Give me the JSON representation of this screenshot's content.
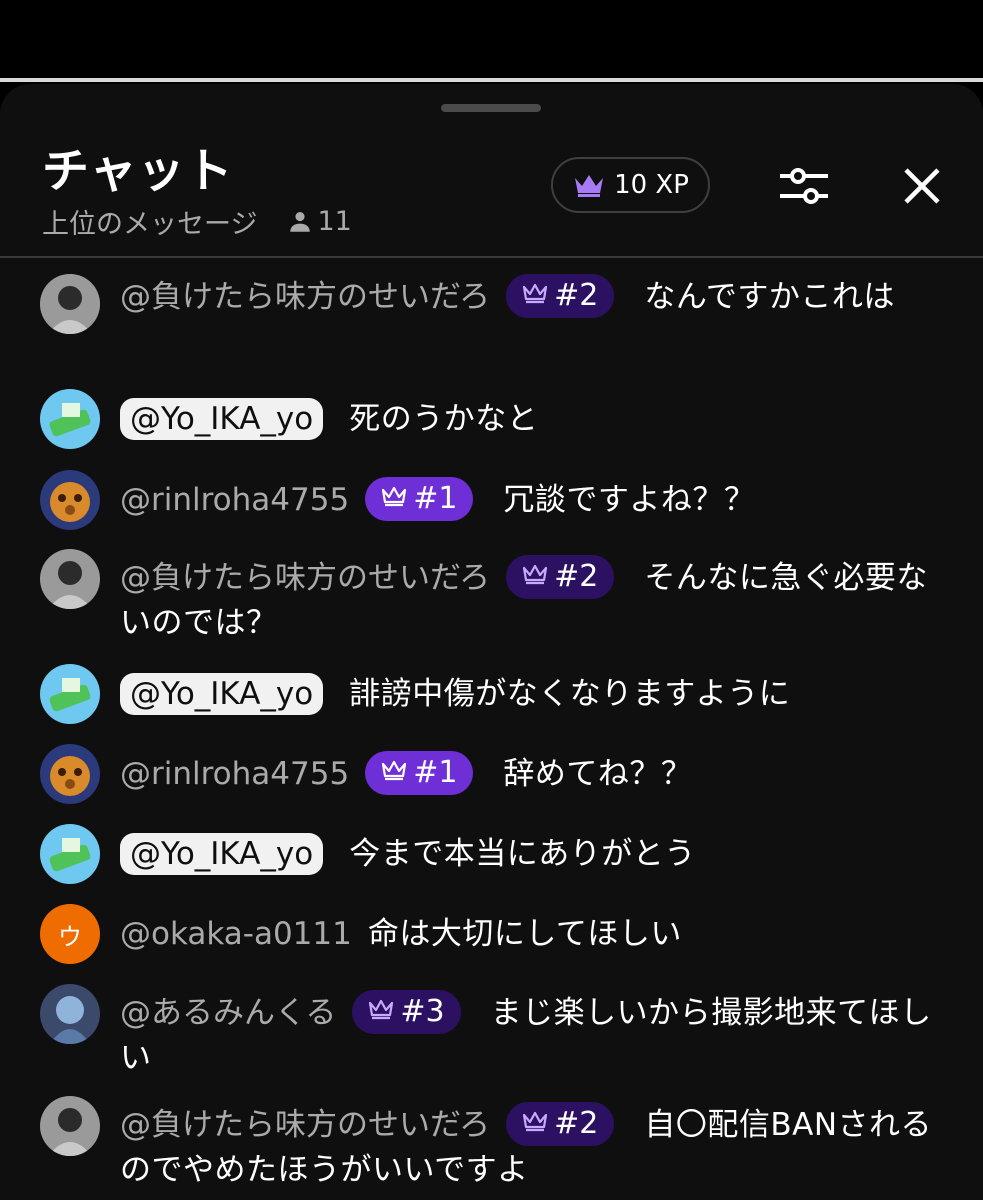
{
  "header": {
    "title": "チャット",
    "subtitle": "上位のメッセージ",
    "viewer_count": "11",
    "xp_label": "10 XP"
  },
  "colors": {
    "sheet": "#0f0f0f",
    "rank1_badge": "#6f2fd6",
    "rank_badge_dark": "#2c1163",
    "owner_chip": "#f1f1f1",
    "author_gray": "#aaaaaa",
    "crown": "#a77bf5"
  },
  "messages": [
    {
      "author": "@負けたら味方のせいだろ",
      "badge": "#2",
      "text": "なんですかこれは"
    },
    {
      "author": "@Yo_IKA_yo",
      "badge": "",
      "text": "死のうかなと"
    },
    {
      "author": "@rinlroha4755",
      "badge": "#1",
      "text": "冗談ですよね？？"
    },
    {
      "author": "@負けたら味方のせいだろ",
      "badge": "#2",
      "text": "そんなに急ぐ必要ないのでは？"
    },
    {
      "author": "@Yo_IKA_yo",
      "badge": "",
      "text": "誹謗中傷がなくなりますように"
    },
    {
      "author": "@rinlroha4755",
      "badge": "#1",
      "text": "辞めてね？？"
    },
    {
      "author": "@Yo_IKA_yo",
      "badge": "",
      "text": "今まで本当にありがとう"
    },
    {
      "author": "@okaka-a0111",
      "badge": "",
      "text": "命は大切にしてほしい",
      "avatar_letter": "ウ"
    },
    {
      "author": "@あるみんくる",
      "badge": "#3",
      "text": "まじ楽しいから撮影地来てほしい"
    },
    {
      "author": "@負けたら味方のせいだろ",
      "badge": "#2",
      "text": "自〇配信BANされるのでやめたほうがいいですよ"
    }
  ]
}
